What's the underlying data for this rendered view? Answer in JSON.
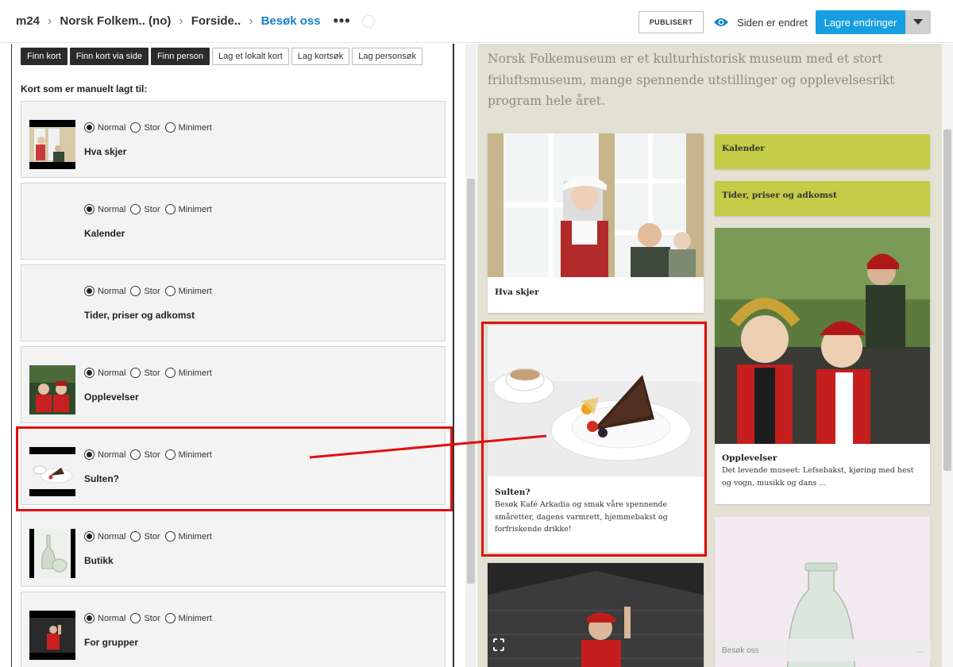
{
  "header": {
    "breadcrumbs": [
      "m24",
      "Norsk Folkem.. (no)",
      "Forside..",
      "Besøk oss"
    ],
    "more_label": "•••",
    "published_label": "PUBLISERT",
    "status_text": "Siden er endret",
    "save_label": "Lagre endringer"
  },
  "toolbar": {
    "buttons": [
      "Finn kort",
      "Finn kort via side",
      "Finn person",
      "Lag et lokalt kort",
      "Lag kortsøk",
      "Lag personsøk"
    ]
  },
  "left": {
    "section_label": "Kort som er manuelt lagt til:",
    "radio_labels": [
      "Normal",
      "Stor",
      "Minimert"
    ],
    "cards": [
      {
        "title": "Hva skjer",
        "selected": "Normal",
        "thumb": "folk-window"
      },
      {
        "title": "Kalender",
        "selected": "Normal",
        "thumb": ""
      },
      {
        "title": "Tider, priser og adkomst",
        "selected": "Normal",
        "thumb": ""
      },
      {
        "title": "Opplevelser",
        "selected": "Normal",
        "thumb": "children-costume"
      },
      {
        "title": "Sulten?",
        "selected": "Normal",
        "thumb": "cake-plate"
      },
      {
        "title": "Butikk",
        "selected": "Normal",
        "thumb": "glass-bottles"
      },
      {
        "title": "For grupper",
        "selected": "Normal",
        "thumb": "guide-dark"
      }
    ]
  },
  "preview": {
    "intro": "Norsk Folkemuseum er et kulturhistorisk museum med et stort friluftsmuseum, mange spennende utstillinger og opplevelsesrikt program hele året.",
    "tiles": {
      "hva_skjer": {
        "title": "Hva skjer"
      },
      "kalender": {
        "title": "Kalender"
      },
      "tider": {
        "title": "Tider, priser og adkomst"
      },
      "opplevelser": {
        "title": "Opplevelser",
        "desc": "Det levende museet: Lefsebakst, kjøring med hest og vogn, musikk og dans ..."
      },
      "sulten": {
        "title": "Sulten?",
        "desc": "Besøk Kafé Arkadia og smak våre spennende småretter, dagens varmrett, hjemmebakst og forfriskende drikke!"
      },
      "besok_tag": {
        "label": "Besøk oss",
        "more": "..."
      }
    }
  },
  "colors": {
    "accent": "#159ee0",
    "breadcrumb_active": "#1a7fc9",
    "highlight": "#e01010",
    "green_tile": "#c4cc48",
    "preview_bg": "#e3e1d4"
  }
}
